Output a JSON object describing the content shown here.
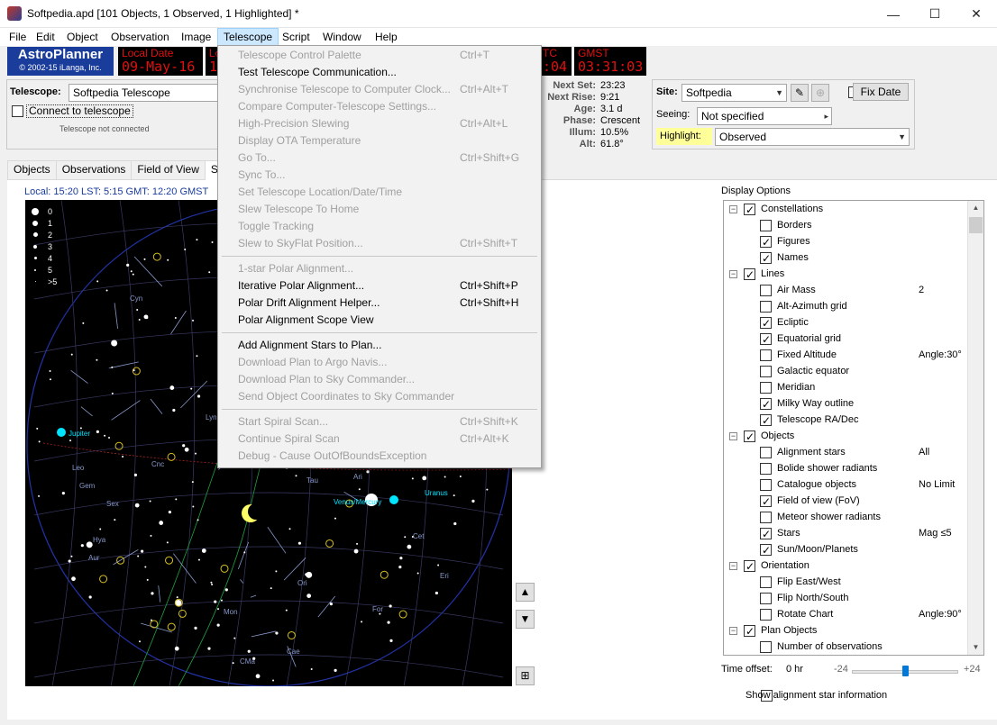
{
  "window": {
    "title": "Softpedia.apd [101 Objects, 1 Observed, 1 Highlighted] *",
    "minimize": "—",
    "maximize": "☐",
    "close": "✕"
  },
  "menubar": [
    "File",
    "Edit",
    "Object",
    "Observation",
    "Image",
    "Telescope",
    "Script",
    "Window",
    "Help"
  ],
  "logo": {
    "title": "AstroPlanner",
    "copyright": "© 2002-15 iLanga, Inc."
  },
  "leds": {
    "local_date_label": "Local Date",
    "local_date": "09-May-16",
    "second_label": "Lo",
    "second_value": "1",
    "utc_label": "TC",
    "utc_value": ":04",
    "gmst_label": "GMST",
    "gmst_value": "03:31:03"
  },
  "telescope_panel": {
    "label": "Telescope:",
    "selected": "Softpedia Telescope",
    "connect_label": "Connect to telescope",
    "status": "Telescope not connected"
  },
  "moon_info": [
    {
      "k": "Next Set:",
      "v": "23:23"
    },
    {
      "k": "Next Rise:",
      "v": "9:21"
    },
    {
      "k": "Age:",
      "v": "3.1 d"
    },
    {
      "k": "Phase:",
      "v": "Crescent"
    },
    {
      "k": "Illum:",
      "v": "10.5%"
    },
    {
      "k": "Alt:",
      "v": "61.8°"
    }
  ],
  "site_panel": {
    "site_label": "Site:",
    "site": "Softpedia",
    "fix_date": "Fix Date",
    "seeing_label": "Seeing:",
    "seeing": "Not specified",
    "highlight_label": "Highlight:",
    "highlight": "Observed"
  },
  "tabs": [
    "Objects",
    "Observations",
    "Field of View",
    "Sky"
  ],
  "time_line": "Local: 15:20   LST: 5:15   GMT: 12:20   GMST",
  "legend": [
    "0",
    "1",
    "2",
    "3",
    "4",
    "5",
    ">5"
  ],
  "sky_labels": {
    "jupiter": "Jupiter",
    "venus_mercury": "Venus/Mercury",
    "uranus": "Uranus",
    "constellations": [
      "Cyn",
      "Lyn",
      "Leo",
      "Cnc",
      "Gem",
      "Tau",
      "Ari",
      "Cet",
      "Eri",
      "For",
      "Cae",
      "Ori",
      "Mon",
      "CMa",
      "Aur",
      "Sex",
      "Hya"
    ]
  },
  "nav": {
    "up": "▲",
    "down": "▼",
    "fov": "⊞"
  },
  "display_options": {
    "label": "Display Options",
    "rows": [
      {
        "level": 0,
        "exp": "−",
        "checked": true,
        "label": "Constellations",
        "value": ""
      },
      {
        "level": 1,
        "checked": false,
        "label": "Borders",
        "value": ""
      },
      {
        "level": 1,
        "checked": true,
        "label": "Figures",
        "value": ""
      },
      {
        "level": 1,
        "checked": true,
        "label": "Names",
        "value": ""
      },
      {
        "level": 0,
        "exp": "−",
        "checked": true,
        "label": "Lines",
        "value": ""
      },
      {
        "level": 1,
        "checked": false,
        "label": "Air Mass",
        "value": "2"
      },
      {
        "level": 1,
        "checked": false,
        "label": "Alt-Azimuth grid",
        "value": ""
      },
      {
        "level": 1,
        "checked": true,
        "label": "Ecliptic",
        "value": ""
      },
      {
        "level": 1,
        "checked": true,
        "label": "Equatorial grid",
        "value": ""
      },
      {
        "level": 1,
        "checked": false,
        "label": "Fixed Altitude",
        "value": "Angle:30°"
      },
      {
        "level": 1,
        "checked": false,
        "label": "Galactic equator",
        "value": ""
      },
      {
        "level": 1,
        "checked": false,
        "label": "Meridian",
        "value": ""
      },
      {
        "level": 1,
        "checked": true,
        "label": "Milky Way outline",
        "value": ""
      },
      {
        "level": 1,
        "checked": true,
        "label": "Telescope RA/Dec",
        "value": ""
      },
      {
        "level": 0,
        "exp": "−",
        "checked": true,
        "label": "Objects",
        "value": ""
      },
      {
        "level": 1,
        "checked": false,
        "label": "Alignment stars",
        "value": "All"
      },
      {
        "level": 1,
        "checked": false,
        "label": "Bolide shower radiants",
        "value": ""
      },
      {
        "level": 1,
        "checked": false,
        "label": "Catalogue objects",
        "value": "No Limit"
      },
      {
        "level": 1,
        "checked": true,
        "label": "Field of view (FoV)",
        "value": ""
      },
      {
        "level": 1,
        "checked": false,
        "label": "Meteor shower radiants",
        "value": ""
      },
      {
        "level": 1,
        "checked": true,
        "label": "Stars",
        "value": "Mag ≤5"
      },
      {
        "level": 1,
        "checked": true,
        "label": "Sun/Moon/Planets",
        "value": ""
      },
      {
        "level": 0,
        "exp": "−",
        "checked": true,
        "label": "Orientation",
        "value": ""
      },
      {
        "level": 1,
        "checked": false,
        "label": "Flip East/West",
        "value": ""
      },
      {
        "level": 1,
        "checked": false,
        "label": "Flip North/South",
        "value": ""
      },
      {
        "level": 1,
        "checked": false,
        "label": "Rotate Chart",
        "value": "Angle:90°"
      },
      {
        "level": 0,
        "exp": "−",
        "checked": true,
        "label": "Plan Objects",
        "value": ""
      },
      {
        "level": 1,
        "checked": false,
        "label": "Number of observations",
        "value": ""
      }
    ]
  },
  "time_offset": {
    "label": "Time offset:",
    "value": "0 hr",
    "min": "-24",
    "max": "+24",
    "level": 0.5
  },
  "show_alignment": "Show alignment star information",
  "telescope_menu": [
    {
      "label": "Telescope Control Palette",
      "shortcut": "Ctrl+T",
      "disabled": true
    },
    {
      "label": "Test Telescope Communication...",
      "shortcut": "",
      "disabled": false
    },
    {
      "label": "Synchronise Telescope to Computer Clock...",
      "shortcut": "Ctrl+Alt+T",
      "disabled": true
    },
    {
      "label": "Compare Computer-Telescope Settings...",
      "shortcut": "",
      "disabled": true
    },
    {
      "label": "High-Precision Slewing",
      "shortcut": "Ctrl+Alt+L",
      "disabled": true
    },
    {
      "label": "Display OTA Temperature",
      "shortcut": "",
      "disabled": true
    },
    {
      "label": "Go To...",
      "shortcut": "Ctrl+Shift+G",
      "disabled": true
    },
    {
      "label": "Sync To...",
      "shortcut": "",
      "disabled": true
    },
    {
      "label": "Set Telescope Location/Date/Time",
      "shortcut": "",
      "disabled": true
    },
    {
      "label": "Slew Telescope To Home",
      "shortcut": "",
      "disabled": true
    },
    {
      "label": "Toggle Tracking",
      "shortcut": "",
      "disabled": true
    },
    {
      "label": "Slew to SkyFlat Position...",
      "shortcut": "Ctrl+Shift+T",
      "disabled": true
    },
    {
      "separator": true
    },
    {
      "label": "1-star Polar Alignment...",
      "shortcut": "",
      "disabled": true
    },
    {
      "label": "Iterative Polar Alignment...",
      "shortcut": "Ctrl+Shift+P",
      "disabled": false
    },
    {
      "label": "Polar Drift Alignment Helper...",
      "shortcut": "Ctrl+Shift+H",
      "disabled": false
    },
    {
      "label": "Polar Alignment Scope View",
      "shortcut": "",
      "disabled": false
    },
    {
      "separator": true
    },
    {
      "label": "Add Alignment Stars to Plan...",
      "shortcut": "",
      "disabled": false
    },
    {
      "label": "Download Plan to Argo Navis...",
      "shortcut": "",
      "disabled": true
    },
    {
      "label": "Download Plan to Sky Commander...",
      "shortcut": "",
      "disabled": true
    },
    {
      "label": "Send Object Coordinates to Sky Commander",
      "shortcut": "",
      "disabled": true
    },
    {
      "separator": true
    },
    {
      "label": "Start Spiral Scan...",
      "shortcut": "Ctrl+Shift+K",
      "disabled": true
    },
    {
      "label": "Continue Spiral Scan",
      "shortcut": "Ctrl+Alt+K",
      "disabled": true
    },
    {
      "label": "Debug - Cause OutOfBoundsException",
      "shortcut": "",
      "disabled": true
    }
  ],
  "colors": {
    "accent": "#1a3d9c",
    "led_text": "#e01010",
    "highlight": "#ffff99",
    "planet": "#00e5ff"
  }
}
